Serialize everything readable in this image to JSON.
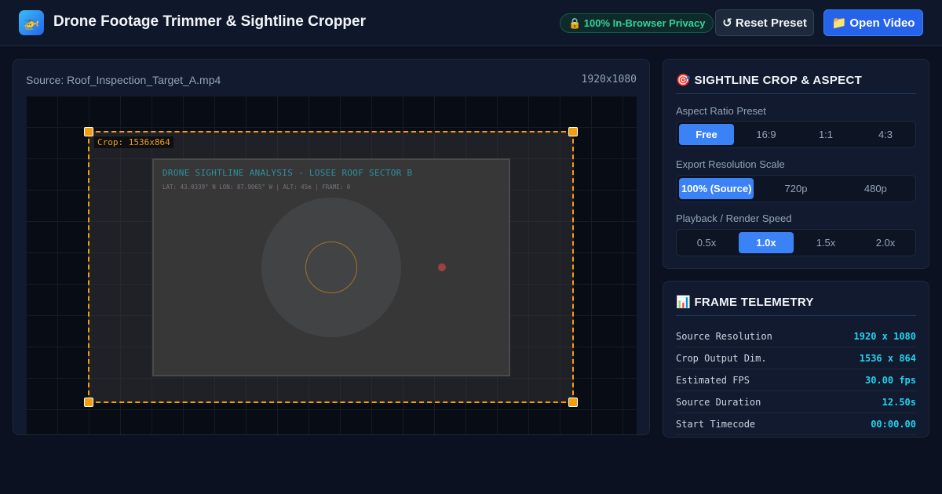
{
  "app": {
    "title": "Drone Footage Trimmer & Sightline Cropper",
    "icon": "drone-icon"
  },
  "header": {
    "privacy_badge": "🔒 100% In-Browser Privacy",
    "reset_label": "↺ Reset Preset",
    "open_label": "📁 Open Video"
  },
  "video": {
    "source_label": "Source: Roof_Inspection_Target_A.mp4",
    "source_resolution": "1920x1080",
    "crop_label": "Crop: 1536x864",
    "overlay_title": "DRONE SIGHTLINE ANALYSIS - LOSEE ROOF SECTOR B",
    "overlay_meta": "LAT: 43.0339° N  LON: 87.9065° W  |  ALT: 45m  |  FRAME: 0"
  },
  "crop_panel": {
    "title": "🎯 SIGHTLINE CROP & ASPECT",
    "aspect": {
      "label": "Aspect Ratio Preset",
      "options": [
        "Free",
        "16:9",
        "1:1",
        "4:3"
      ],
      "selected": "Free"
    },
    "scale": {
      "label": "Export Resolution Scale",
      "options": [
        "100% (Source)",
        "720p",
        "480p"
      ],
      "selected": "100% (Source)"
    },
    "speed": {
      "label": "Playback / Render Speed",
      "options": [
        "0.5x",
        "1.0x",
        "1.5x",
        "2.0x"
      ],
      "selected": "1.0x"
    }
  },
  "telemetry": {
    "title": "📊 FRAME TELEMETRY",
    "rows": [
      {
        "key": "Source Resolution",
        "value": "1920 x 1080"
      },
      {
        "key": "Crop Output Dim.",
        "value": "1536 x 864"
      },
      {
        "key": "Estimated FPS",
        "value": "30.00 fps"
      },
      {
        "key": "Source Duration",
        "value": "12.50s"
      },
      {
        "key": "Start Timecode",
        "value": "00:00.00"
      }
    ]
  },
  "colors": {
    "accent": "#3b82f6",
    "crop": "#f59e0b",
    "telemetry_value": "#22d3ee",
    "privacy": "#34d399",
    "marker": "#ef4444"
  }
}
